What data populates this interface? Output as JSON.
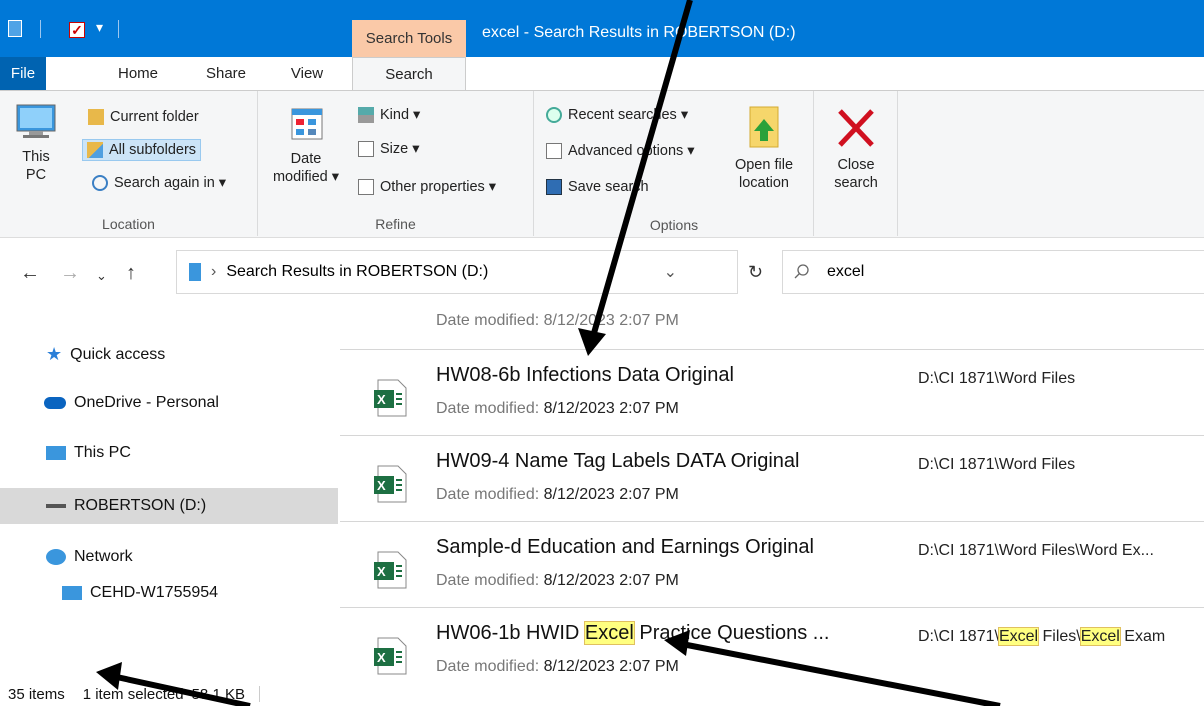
{
  "window": {
    "title": "excel - Search Results in ROBERTSON (D:)",
    "context_tab": "Search Tools"
  },
  "tabs": [
    "File",
    "Home",
    "Share",
    "View",
    "Search"
  ],
  "ribbon": {
    "location": {
      "label": "Location",
      "this_pc_line1": "This",
      "this_pc_line2": "PC",
      "current_folder": "Current folder",
      "all_subfolders": "All subfolders",
      "search_again": "Search again in ▾"
    },
    "refine": {
      "label": "Refine",
      "date_line1": "Date",
      "date_line2": "modified ▾",
      "kind": "Kind ▾",
      "size": "Size ▾",
      "other": "Other properties ▾"
    },
    "options": {
      "label": "Options",
      "recent": "Recent searches ▾",
      "advanced": "Advanced options ▾",
      "save": "Save search",
      "open_line1": "Open file",
      "open_line2": "location",
      "close_line1": "Close",
      "close_line2": "search"
    }
  },
  "address": {
    "path": "Search Results in ROBERTSON (D:)",
    "search_value": "excel"
  },
  "nav": {
    "quick_access": "Quick access",
    "onedrive": "OneDrive - Personal",
    "this_pc": "This PC",
    "drive": "ROBERTSON (D:)",
    "network": "Network",
    "computer": "CEHD-W1755954"
  },
  "files": {
    "partial_date": "Date modified: 8/12/2023 2:07 PM",
    "date_label": "Date modified: ",
    "date_value": "8/12/2023 2:07 PM",
    "rows": [
      {
        "name": "HW08-6b Infections Data Original",
        "path": "D:\\CI 1871\\Word Files"
      },
      {
        "name": "HW09-4 Name Tag Labels DATA Original",
        "path": "D:\\CI 1871\\Word Files"
      },
      {
        "name": "Sample-d Education and Earnings Original",
        "path": "D:\\CI 1871\\Word Files\\Word Ex..."
      },
      {
        "name_pre": "HW06-1b HWID ",
        "name_hl": "Excel",
        "name_post": " Practice Questions ...",
        "path_pre": "D:\\CI 1871\\",
        "path_hl1": "Excel",
        "path_mid": " Files\\",
        "path_hl2": "Excel",
        "path_post": " Exam"
      }
    ]
  },
  "status": {
    "items": "35 items",
    "selected": "1 item selected",
    "size": "58.1 KB"
  },
  "colors": {
    "titlebar": "#0078d7",
    "context_tab": "#fac9a8",
    "highlight": "#ffff80",
    "excel_green": "#1d6f42"
  }
}
